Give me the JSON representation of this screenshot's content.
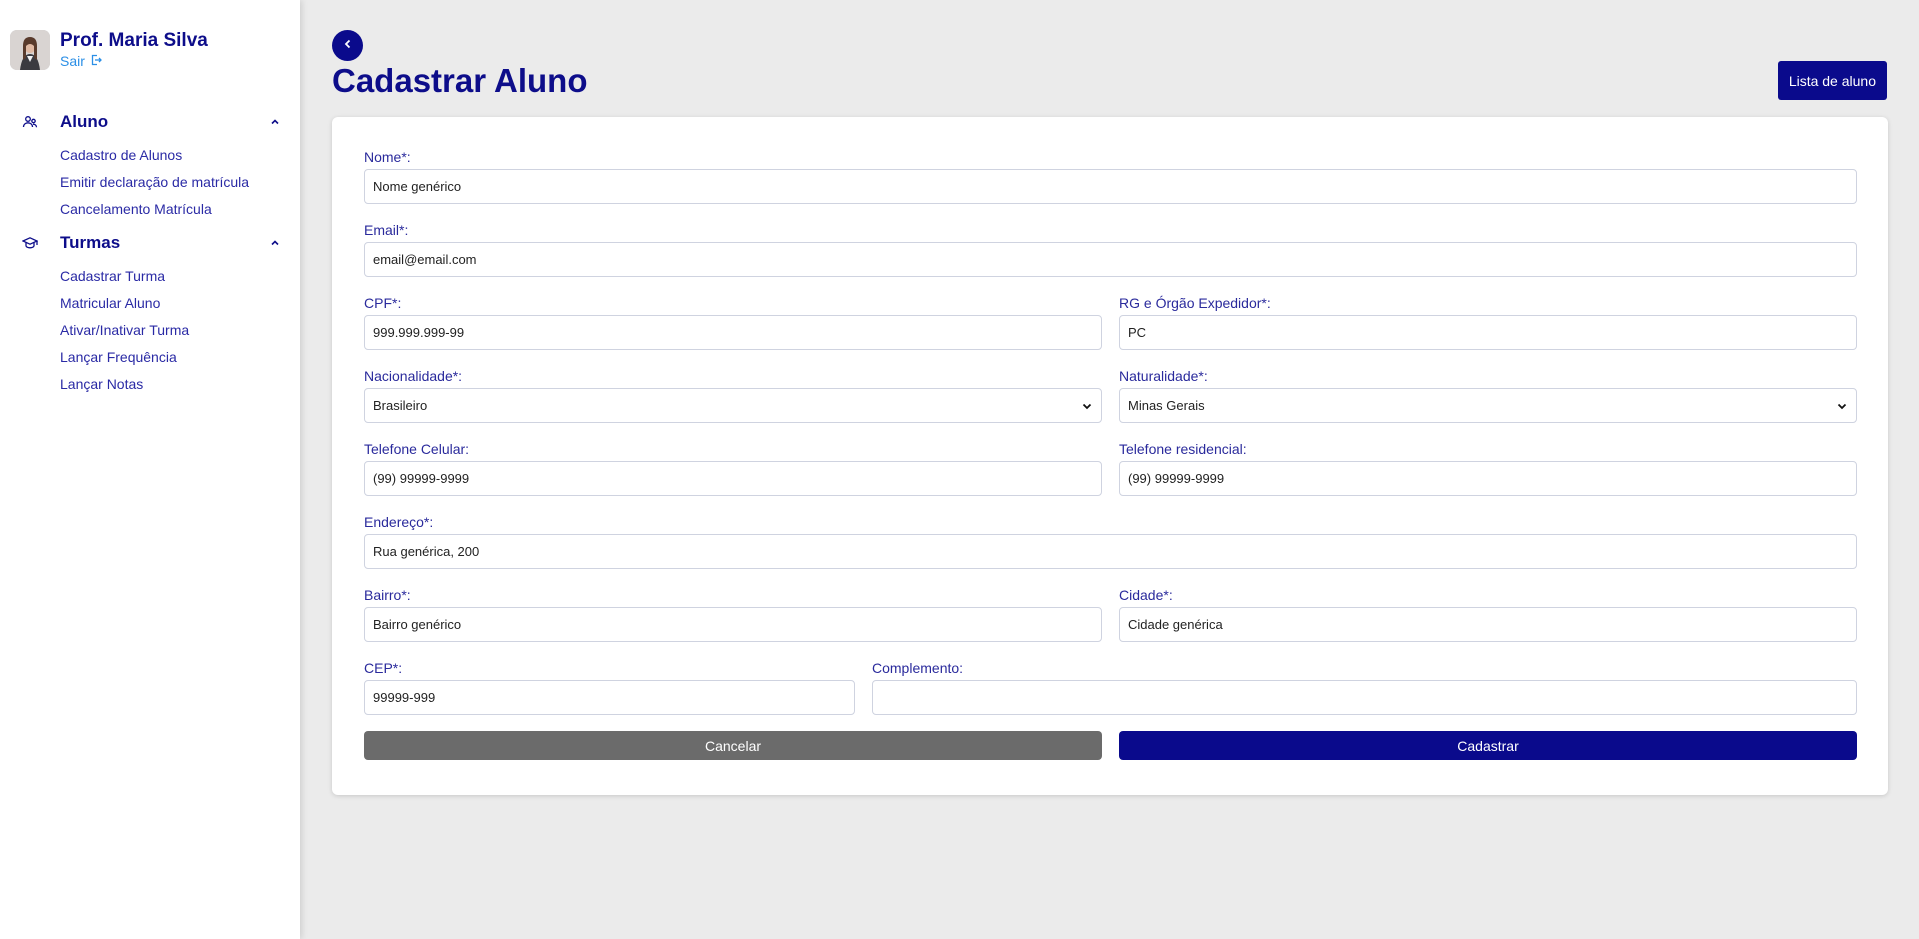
{
  "user": {
    "name": "Prof. Maria Silva",
    "logout_label": "Sair"
  },
  "nav": [
    {
      "title": "Aluno",
      "icon": "users-icon",
      "items": [
        "Cadastro de Alunos",
        "Emitir declaração de matrícula",
        "Cancelamento Matrícula"
      ]
    },
    {
      "title": "Turmas",
      "icon": "graduation-cap-icon",
      "items": [
        "Cadastrar Turma",
        "Matricular Aluno",
        "Ativar/Inativar Turma",
        "Lançar Frequência",
        "Lançar Notas"
      ]
    }
  ],
  "page": {
    "title": "Cadastrar Aluno",
    "list_button": "Lista de aluno"
  },
  "form": {
    "nome": {
      "label": "Nome*:",
      "value": "Nome genérico"
    },
    "email": {
      "label": "Email*:",
      "value": "email@email.com"
    },
    "cpf": {
      "label": "CPF*:",
      "value": "999.999.999-99"
    },
    "rg": {
      "label": "RG e Órgão Expedidor*:",
      "value": "PC"
    },
    "nacionalidade": {
      "label": "Nacionalidade*:",
      "value": "Brasileiro"
    },
    "naturalidade": {
      "label": "Naturalidade*:",
      "value": "Minas Gerais"
    },
    "celular": {
      "label": "Telefone Celular:",
      "value": "(99) 99999-9999"
    },
    "residencial": {
      "label": "Telefone residencial:",
      "value": "(99) 99999-9999"
    },
    "endereco": {
      "label": "Endereço*:",
      "value": "Rua genérica, 200"
    },
    "bairro": {
      "label": "Bairro*:",
      "value": "Bairro genérico"
    },
    "cidade": {
      "label": "Cidade*:",
      "value": "Cidade genérica"
    },
    "cep": {
      "label": "CEP*:",
      "value": "99999-999"
    },
    "complemento": {
      "label": "Complemento:",
      "value": ""
    },
    "cancel_label": "Cancelar",
    "submit_label": "Cadastrar"
  },
  "colors": {
    "primary": "#0a0a8c",
    "cancel": "#6b6b6b",
    "link": "#2b8fe6",
    "background": "#ebebeb"
  }
}
